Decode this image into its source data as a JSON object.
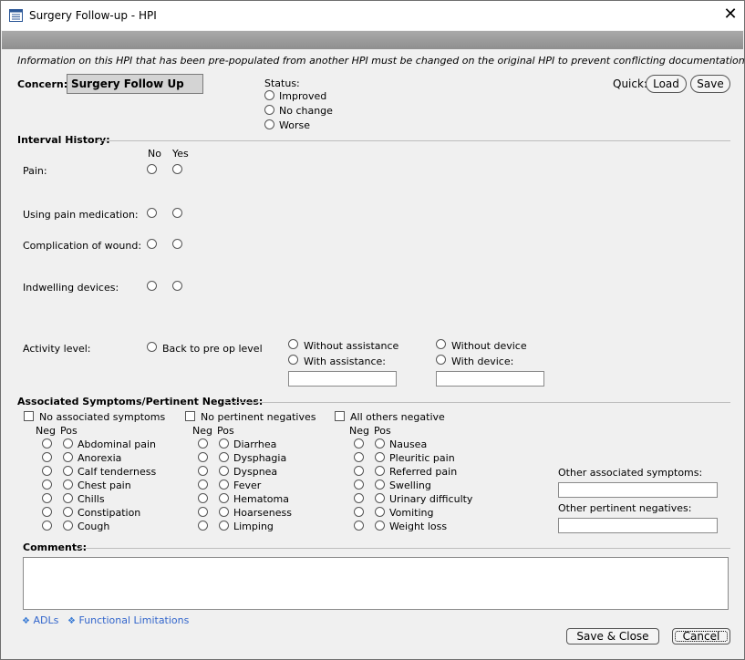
{
  "window": {
    "title": "Surgery Follow-up - HPI",
    "close_glyph": "✕"
  },
  "info_text": "Information on this HPI that has been pre-populated from another HPI must be changed on the original HPI to prevent conflicting documentation.",
  "concern": {
    "label": "Concern:",
    "value": "Surgery Follow Up"
  },
  "status": {
    "label": "Status:",
    "options": [
      "Improved",
      "No change",
      "Worse"
    ]
  },
  "quick": {
    "label": "Quick:",
    "load": "Load",
    "save": "Save"
  },
  "interval_history": {
    "title": "Interval History:",
    "col_no": "No",
    "col_yes": "Yes",
    "rows": [
      "Pain:",
      "Using pain medication:",
      "Complication of wound:",
      "Indwelling devices:"
    ],
    "activity": {
      "label": "Activity level:",
      "back_to_preop": "Back to pre op level",
      "without_assistance": "Without assistance",
      "with_assistance": "With assistance:",
      "without_device": "Without device",
      "with_device": "With device:"
    }
  },
  "assoc": {
    "title": "Associated Symptoms/Pertinent Negatives:",
    "no_assoc": "No associated symptoms",
    "no_pert": "No pertinent negatives",
    "all_neg": "All others negative",
    "neg": "Neg",
    "pos": "Pos",
    "col1": [
      "Abdominal pain",
      "Anorexia",
      "Calf tenderness",
      "Chest pain",
      "Chills",
      "Constipation",
      "Cough"
    ],
    "col2": [
      "Diarrhea",
      "Dysphagia",
      "Dyspnea",
      "Fever",
      "Hematoma",
      "Hoarseness",
      "Limping"
    ],
    "col3": [
      "Nausea",
      "Pleuritic pain",
      "Referred pain",
      "Swelling",
      "Urinary difficulty",
      "Vomiting",
      "Weight loss"
    ],
    "other_assoc": "Other associated symptoms:",
    "other_neg": "Other pertinent negatives:"
  },
  "comments": {
    "label": "Comments:"
  },
  "links": {
    "adls": "ADLs",
    "functional": "Functional Limitations",
    "bullet": "❖"
  },
  "footer": {
    "save_close": "Save & Close",
    "cancel": "Cancel"
  }
}
